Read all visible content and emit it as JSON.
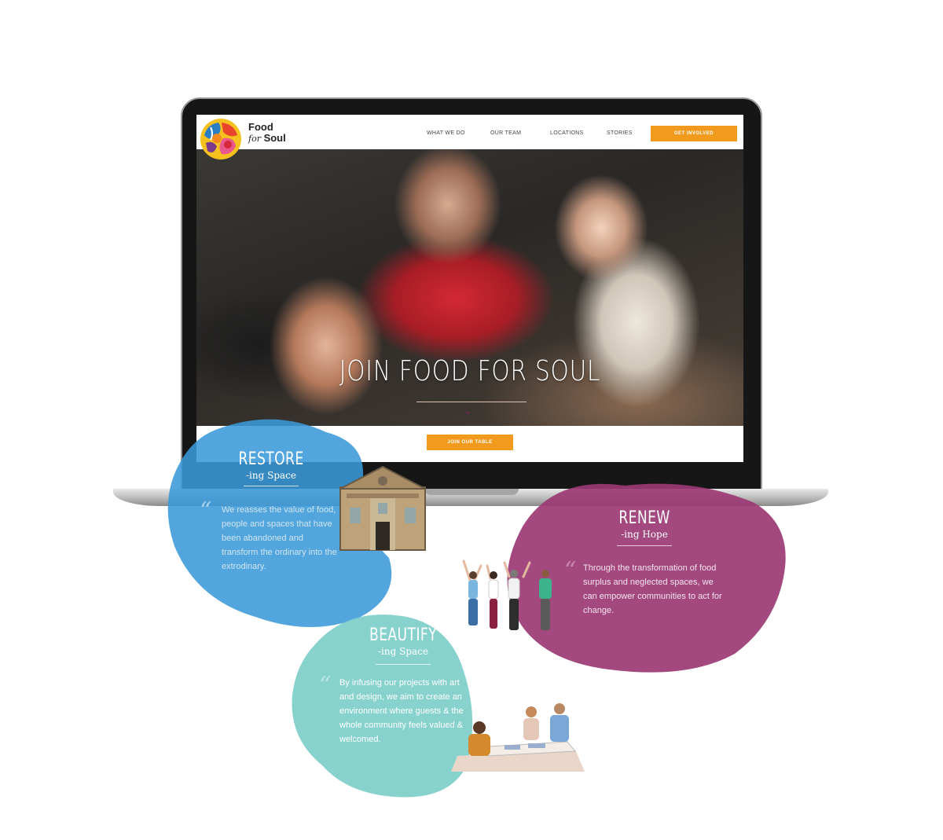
{
  "site": {
    "logo_line1": "Food",
    "logo_line2_em": "for",
    "logo_line2": " Soul",
    "nav": [
      "WHAT WE DO",
      "OUR TEAM",
      "LOCATIONS",
      "STORIES"
    ],
    "cta_top": "GET INVOLVED",
    "hero_title": "JOIN FOOD FOR SOUL",
    "cta_bottom": "JOIN OUR TABLE"
  },
  "cards": {
    "restore": {
      "title": "RESTORE",
      "subtitle": "-ing Space",
      "text": "We reasses the value of food, people and spaces that have been abandoned and transform the ordinary into the extrodinary."
    },
    "renew": {
      "title": "RENEW",
      "subtitle": "-ing Hope",
      "text": "Through the transformation of food surplus and neglected spaces, we can empower communities to act for change."
    },
    "beautify": {
      "title": "BEAUTIFY",
      "subtitle": "-ing Space",
      "text": "By infusing our projects with art and design, we aim to create an environment where guests & the whole community feels valued & welcomed."
    }
  },
  "colors": {
    "accent_orange": "#f29a1e",
    "blue_blob": "#3a9ad8",
    "purple_blob": "#9c3a74",
    "teal_blob": "#7ecec9"
  }
}
